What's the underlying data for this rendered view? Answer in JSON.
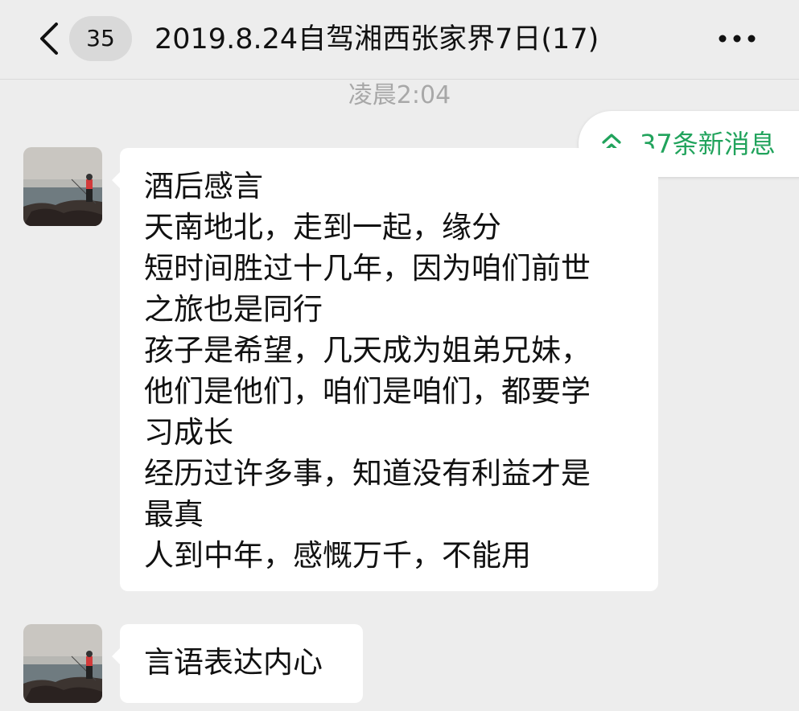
{
  "header": {
    "unread_count": "35",
    "title": "2019.8.24自驾湘西张家界7日(17)",
    "back_icon": "chevron-left-icon",
    "more_icon": "more-dots-icon"
  },
  "timestamp": "凌晨2:04",
  "new_messages": {
    "label": "37条新消息",
    "icon": "double-chevron-up-icon",
    "color": "#21a35c"
  },
  "messages": [
    {
      "lines": [
        "酒后感言",
        "天南地北，走到一起，缘分",
        "短时间胜过十几年，因为咱们前世",
        "之旅也是同行",
        "孩子是希望，几天成为姐弟兄妹，",
        "他们是他们，咱们是咱们，都要学",
        "习成长",
        "经历过许多事，知道没有利益才是",
        "最真",
        "人到中年，感慨万千，不能用"
      ]
    },
    {
      "lines": [
        "言语表达内心"
      ]
    }
  ]
}
